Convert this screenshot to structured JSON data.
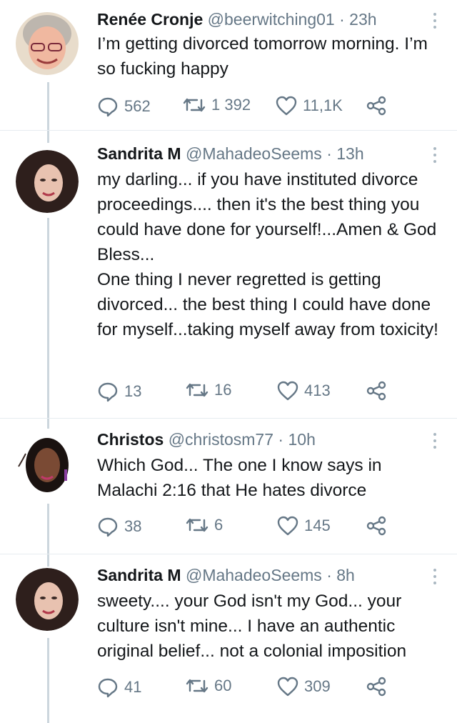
{
  "tweets": [
    {
      "name": "Renée Cronje",
      "handle": "@beerwitching01",
      "time": "23h",
      "text": "I’m getting divorced tomorrow morning. I’m so fucking happy",
      "replies": "562",
      "retweets": "1 392",
      "likes": "11,1K",
      "avatar_bg": "#d9d2c9"
    },
    {
      "name": "Sandrita M",
      "handle": "@MahadeoSeems",
      "time": "13h",
      "text": "my darling... if you have instituted divorce proceedings.... then it's the best thing you could have done for yourself!...Amen & God Bless...\nOne thing I never regretted is getting divorced... the best thing I could have done for myself...taking myself away from toxicity!",
      "replies": "13",
      "retweets": "16",
      "likes": "413",
      "avatar_bg": "#3a2a26"
    },
    {
      "name": "Christos",
      "handle": "@christosm77",
      "time": "10h",
      "text": "Which God... The one I know says in Malachi 2:16 that He hates divorce",
      "replies": "38",
      "retweets": "6",
      "likes": "145",
      "avatar_bg": "#ffffff"
    },
    {
      "name": "Sandrita M",
      "handle": "@MahadeoSeems",
      "time": "8h",
      "text": "sweety.... your God isn't my God... your culture isn't mine... I have an authentic original belief... not a colonial imposition",
      "replies": "41",
      "retweets": "60",
      "likes": "309",
      "avatar_bg": "#3a2a26"
    }
  ],
  "separator": "·",
  "icons": {
    "reply": "reply-icon",
    "retweet": "retweet-icon",
    "like": "heart-icon",
    "share": "share-icon",
    "more": "more-options-icon"
  },
  "colors": {
    "text": "#14171a",
    "secondary": "#657786",
    "thread_line": "#ccd6dd"
  }
}
